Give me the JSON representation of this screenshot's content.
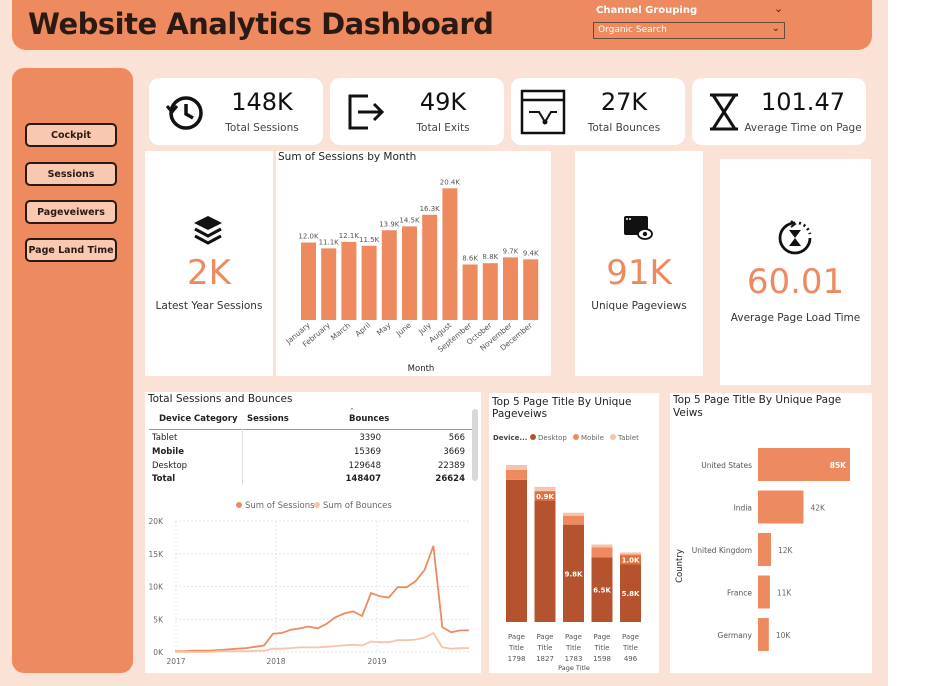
{
  "header": {
    "title": "Website Analytics Dashboard",
    "slicer_label": "Channel Grouping",
    "slicer_value": "Organic Search"
  },
  "nav": [
    {
      "label": "Cockpit"
    },
    {
      "label": "Sessions"
    },
    {
      "label": "Pageveiwers"
    },
    {
      "label": "Page Land Time"
    }
  ],
  "kpis": [
    {
      "value": "148K",
      "label": "Total Sessions",
      "icon": "history-clock-icon"
    },
    {
      "value": "49K",
      "label": "Total Exits",
      "icon": "exit-arrow-icon"
    },
    {
      "value": "27K",
      "label": "Total Bounces",
      "icon": "browser-bounce-icon"
    },
    {
      "value": "101.47",
      "label": "Average Time on Page",
      "icon": "hourglass-icon"
    }
  ],
  "latest_year": {
    "value": "2K",
    "label": "Latest Year Sessions",
    "icon": "layers-icon"
  },
  "unique_pageviews": {
    "value": "91K",
    "label": "Unique Pageviews",
    "icon": "browser-eye-icon"
  },
  "avg_load": {
    "value": "60.01",
    "label": "Average Page Load Time",
    "icon": "timer-hourglass-icon"
  },
  "colors": {
    "accent": "#ee8a5f",
    "dark": "#b5532e",
    "light": "#f6c4ab",
    "bg": "#fbe2d7"
  },
  "chart_data": [
    {
      "type": "bar",
      "title": "Sum of Sessions by Month",
      "xlabel": "Month",
      "ylabel": "",
      "categories": [
        "January",
        "February",
        "March",
        "April",
        "May",
        "June",
        "July",
        "August",
        "September",
        "October",
        "November",
        "December"
      ],
      "values": [
        12.0,
        11.1,
        12.1,
        11.5,
        13.9,
        14.5,
        16.3,
        20.4,
        8.6,
        8.8,
        9.7,
        9.4
      ],
      "labels": [
        "12.0K",
        "11.1K",
        "12.1K",
        "11.5K",
        "13.9K",
        "14.5K",
        "16.3K",
        "20.4K",
        "8.6K",
        "8.8K",
        "9.7K",
        "9.4K"
      ],
      "ylim": [
        0,
        22
      ]
    },
    {
      "type": "table",
      "title": "Total Sessions and Bounces",
      "columns": [
        "Device Category",
        "Sessions",
        "Bounces"
      ],
      "rows": [
        [
          "Tablet",
          "3390",
          "566"
        ],
        [
          "Mobile",
          "15369",
          "3669"
        ],
        [
          "Desktop",
          "129648",
          "22389"
        ],
        [
          "Total",
          "148407",
          "26624"
        ]
      ]
    },
    {
      "type": "line",
      "legend": [
        "Sum of Sessions",
        "Sum of Bounces"
      ],
      "legend_position": "top",
      "y_ticks": [
        "0K",
        "5K",
        "10K",
        "15K",
        "20K"
      ],
      "x_ticks": [
        "2017",
        "2018",
        "2019"
      ],
      "ylim": [
        0,
        20
      ],
      "grid": true,
      "series": [
        {
          "name": "Sum of Sessions",
          "values": [
            0.1,
            0.1,
            0.2,
            0.2,
            0.2,
            0.3,
            0.4,
            0.5,
            0.6,
            0.8,
            1.0,
            2.8,
            2.9,
            3.4,
            3.6,
            3.9,
            3.6,
            4.3,
            5.3,
            5.9,
            6.2,
            5.5,
            9.0,
            8.5,
            8.3,
            9.9,
            9.9,
            10.8,
            12.5,
            16.2,
            3.8,
            3.0,
            3.3,
            3.3
          ]
        },
        {
          "name": "Sum of Bounces",
          "values": [
            0.0,
            0.0,
            0.0,
            0.0,
            0.0,
            0.1,
            0.1,
            0.1,
            0.1,
            0.2,
            0.2,
            0.5,
            0.5,
            0.6,
            0.7,
            0.7,
            0.7,
            0.8,
            0.9,
            1.0,
            1.1,
            1.0,
            1.6,
            1.5,
            1.5,
            1.8,
            1.8,
            1.9,
            2.2,
            2.9,
            0.7,
            0.5,
            0.6,
            0.6
          ]
        }
      ]
    },
    {
      "type": "bar",
      "title": "Top 5 Page Title By Unique Pageveiws",
      "stacked": true,
      "legend_title": "Device...",
      "legend": [
        "Desktop",
        "Mobile",
        "Tablet"
      ],
      "xlabel": "Page Title",
      "categories": [
        "Page Title 1798",
        "Page Title 1827",
        "Page Title 1783",
        "Page Title 1598",
        "Page Title 496"
      ],
      "series": [
        {
          "name": "Desktop",
          "values": [
            14.3,
            12.3,
            9.8,
            6.5,
            5.8
          ]
        },
        {
          "name": "Mobile",
          "values": [
            1.0,
            0.9,
            0.9,
            1.0,
            1.0
          ]
        },
        {
          "name": "Tablet",
          "values": [
            0.5,
            0.4,
            0.3,
            0.3,
            0.2
          ]
        }
      ],
      "data_labels": [
        "",
        "0.9K",
        "9.8K",
        "6.5K",
        "5.8K",
        "1.0K"
      ]
    },
    {
      "type": "bar",
      "orientation": "horizontal",
      "title": "Top 5 Page Title By Unique Page Veiws",
      "ylabel": "Country",
      "categories": [
        "United States",
        "India",
        "United Kingdom",
        "France",
        "Germany"
      ],
      "values": [
        85,
        42,
        12,
        11,
        10
      ],
      "labels": [
        "85K",
        "42K",
        "12K",
        "11K",
        "10K"
      ]
    }
  ]
}
